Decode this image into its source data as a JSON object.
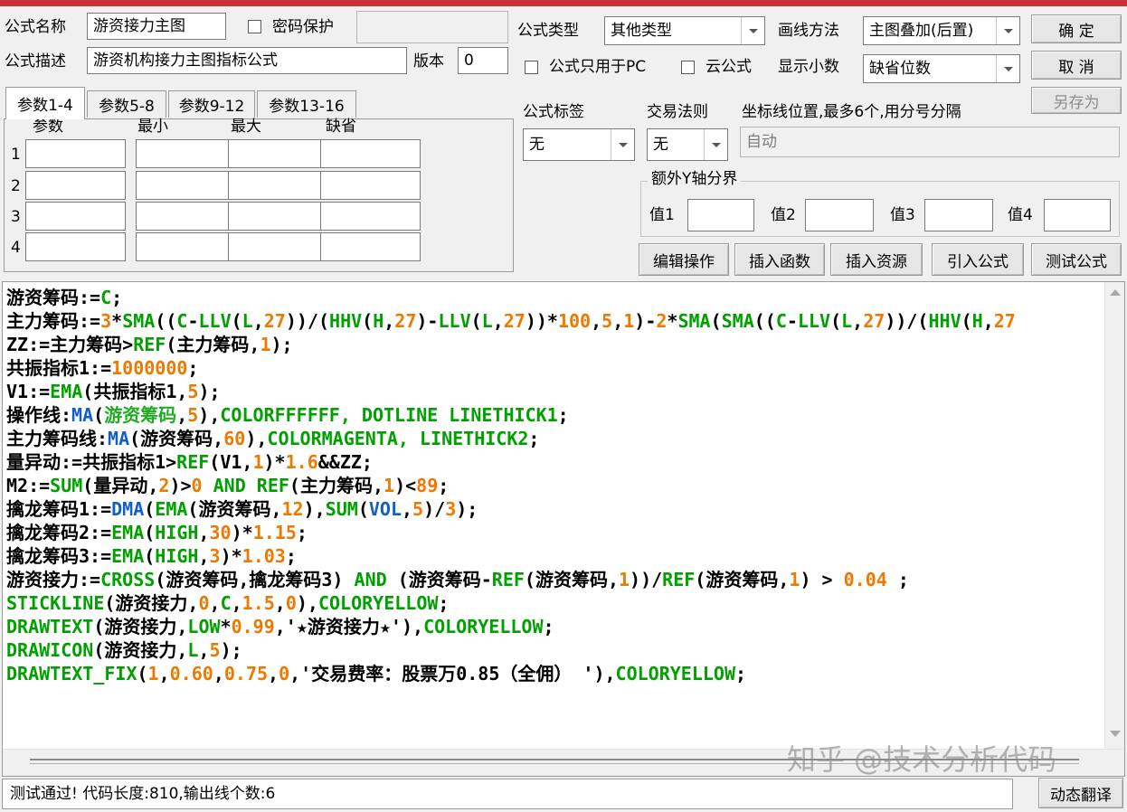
{
  "colors": {
    "code_default": "#000000",
    "code_keyword": "#00a000",
    "code_function": "#1060c8",
    "code_number": "#f07800",
    "code_highlight": "#22aa22",
    "accent_top": "#c9303a"
  },
  "header": {
    "name_label": "公式名称",
    "name_value": "游资接力主图",
    "password_label": "密码保护",
    "desc_label": "公式描述",
    "desc_value": "游资机构接力主图指标公式",
    "version_label": "版本",
    "version_value": "0",
    "type_label": "公式类型",
    "type_value": "其他类型",
    "draw_label": "画线方法",
    "draw_value": "主图叠加(后置)",
    "pc_only_label": "公式只用于PC",
    "cloud_label": "云公式",
    "decimals_label": "显示小数",
    "decimals_value": "缺省位数"
  },
  "buttons": {
    "ok": "确  定",
    "cancel": "取  消",
    "save_as": "另存为",
    "edit_ops": "编辑操作",
    "insert_func": "插入函数",
    "insert_resource": "插入资源",
    "import_formula": "引入公式",
    "test_formula": "测试公式",
    "dynamic_translate": "动态翻译"
  },
  "tabs": [
    "参数1-4",
    "参数5-8",
    "参数9-12",
    "参数13-16"
  ],
  "params": {
    "headers": [
      "参数",
      "最小",
      "最大",
      "缺省"
    ],
    "rows": [
      "1",
      "2",
      "3",
      "4"
    ]
  },
  "tags": {
    "tag_label": "公式标签",
    "tag_value": "无",
    "rule_label": "交易法则",
    "rule_value": "无",
    "axis_label": "坐标线位置,最多6个,用分号分隔",
    "axis_placeholder": "自动"
  },
  "y_axis": {
    "group_label": "额外Y轴分界",
    "v1": "值1",
    "v2": "值2",
    "v3": "值3",
    "v4": "值4"
  },
  "code": [
    [
      {
        "t": "游资筹码:=",
        "c": "d"
      },
      {
        "t": "C",
        "c": "k"
      },
      {
        "t": ";",
        "c": "d"
      }
    ],
    [
      {
        "t": "主力筹码:=",
        "c": "d"
      },
      {
        "t": "3",
        "c": "n"
      },
      {
        "t": "*",
        "c": "d"
      },
      {
        "t": "SMA",
        "c": "k"
      },
      {
        "t": "((",
        "c": "d"
      },
      {
        "t": "C",
        "c": "k"
      },
      {
        "t": "-",
        "c": "d"
      },
      {
        "t": "LLV",
        "c": "k"
      },
      {
        "t": "(",
        "c": "d"
      },
      {
        "t": "L",
        "c": "k"
      },
      {
        "t": ",",
        "c": "d"
      },
      {
        "t": "27",
        "c": "n"
      },
      {
        "t": "))/(",
        "c": "d"
      },
      {
        "t": "HHV",
        "c": "k"
      },
      {
        "t": "(",
        "c": "d"
      },
      {
        "t": "H",
        "c": "k"
      },
      {
        "t": ",",
        "c": "d"
      },
      {
        "t": "27",
        "c": "n"
      },
      {
        "t": ")-",
        "c": "d"
      },
      {
        "t": "LLV",
        "c": "k"
      },
      {
        "t": "(",
        "c": "d"
      },
      {
        "t": "L",
        "c": "k"
      },
      {
        "t": ",",
        "c": "d"
      },
      {
        "t": "27",
        "c": "n"
      },
      {
        "t": "))*",
        "c": "d"
      },
      {
        "t": "100",
        "c": "n"
      },
      {
        "t": ",",
        "c": "d"
      },
      {
        "t": "5",
        "c": "n"
      },
      {
        "t": ",",
        "c": "d"
      },
      {
        "t": "1",
        "c": "n"
      },
      {
        "t": ")-",
        "c": "d"
      },
      {
        "t": "2",
        "c": "n"
      },
      {
        "t": "*",
        "c": "d"
      },
      {
        "t": "SMA",
        "c": "k"
      },
      {
        "t": "(",
        "c": "d"
      },
      {
        "t": "SMA",
        "c": "k"
      },
      {
        "t": "((",
        "c": "d"
      },
      {
        "t": "C",
        "c": "k"
      },
      {
        "t": "-",
        "c": "d"
      },
      {
        "t": "LLV",
        "c": "k"
      },
      {
        "t": "(",
        "c": "d"
      },
      {
        "t": "L",
        "c": "k"
      },
      {
        "t": ",",
        "c": "d"
      },
      {
        "t": "27",
        "c": "n"
      },
      {
        "t": "))/(",
        "c": "d"
      },
      {
        "t": "HHV",
        "c": "k"
      },
      {
        "t": "(",
        "c": "d"
      },
      {
        "t": "H",
        "c": "k"
      },
      {
        "t": ",",
        "c": "d"
      },
      {
        "t": "27",
        "c": "n"
      }
    ],
    [
      {
        "t": "ZZ:=主力筹码>",
        "c": "d"
      },
      {
        "t": "REF",
        "c": "k"
      },
      {
        "t": "(主力筹码,",
        "c": "d"
      },
      {
        "t": "1",
        "c": "n"
      },
      {
        "t": ");",
        "c": "d"
      }
    ],
    [
      {
        "t": "共振指标1:=",
        "c": "d"
      },
      {
        "t": "1000000",
        "c": "n"
      },
      {
        "t": ";",
        "c": "d"
      }
    ],
    [
      {
        "t": "V1:=",
        "c": "d"
      },
      {
        "t": "EMA",
        "c": "k"
      },
      {
        "t": "(共振指标1,",
        "c": "d"
      },
      {
        "t": "5",
        "c": "n"
      },
      {
        "t": ");",
        "c": "d"
      }
    ],
    [
      {
        "t": "操作线:",
        "c": "d"
      },
      {
        "t": "MA",
        "c": "f"
      },
      {
        "t": "(",
        "c": "d"
      },
      {
        "t": "游资筹码",
        "c": "h"
      },
      {
        "t": ",",
        "c": "d"
      },
      {
        "t": "5",
        "c": "n"
      },
      {
        "t": "),",
        "c": "d"
      },
      {
        "t": "COLORFFFFFF, DOTLINE LINETHICK1",
        "c": "k"
      },
      {
        "t": ";",
        "c": "d"
      }
    ],
    [
      {
        "t": "主力筹码线:",
        "c": "d"
      },
      {
        "t": "MA",
        "c": "f"
      },
      {
        "t": "(游资筹码,",
        "c": "d"
      },
      {
        "t": "60",
        "c": "n"
      },
      {
        "t": "),",
        "c": "d"
      },
      {
        "t": "COLORMAGENTA, LINETHICK2",
        "c": "k"
      },
      {
        "t": ";",
        "c": "d"
      }
    ],
    [
      {
        "t": "量异动:=共振指标1>",
        "c": "d"
      },
      {
        "t": "REF",
        "c": "k"
      },
      {
        "t": "(V1,",
        "c": "d"
      },
      {
        "t": "1",
        "c": "n"
      },
      {
        "t": ")*",
        "c": "d"
      },
      {
        "t": "1.6",
        "c": "n"
      },
      {
        "t": "&&ZZ;",
        "c": "d"
      }
    ],
    [
      {
        "t": "M2:=",
        "c": "d"
      },
      {
        "t": "SUM",
        "c": "k"
      },
      {
        "t": "(量异动,",
        "c": "d"
      },
      {
        "t": "2",
        "c": "n"
      },
      {
        "t": ")>",
        "c": "d"
      },
      {
        "t": "0",
        "c": "n"
      },
      {
        "t": " ",
        "c": "d"
      },
      {
        "t": "AND",
        "c": "k"
      },
      {
        "t": " ",
        "c": "d"
      },
      {
        "t": "REF",
        "c": "k"
      },
      {
        "t": "(主力筹码,",
        "c": "d"
      },
      {
        "t": "1",
        "c": "n"
      },
      {
        "t": ")<",
        "c": "d"
      },
      {
        "t": "89",
        "c": "n"
      },
      {
        "t": ";",
        "c": "d"
      }
    ],
    [
      {
        "t": "擒龙筹码1:=",
        "c": "d"
      },
      {
        "t": "DMA",
        "c": "f"
      },
      {
        "t": "(",
        "c": "d"
      },
      {
        "t": "EMA",
        "c": "k"
      },
      {
        "t": "(游资筹码,",
        "c": "d"
      },
      {
        "t": "12",
        "c": "n"
      },
      {
        "t": "),",
        "c": "d"
      },
      {
        "t": "SUM",
        "c": "k"
      },
      {
        "t": "(",
        "c": "d"
      },
      {
        "t": "VOL",
        "c": "f"
      },
      {
        "t": ",",
        "c": "d"
      },
      {
        "t": "5",
        "c": "n"
      },
      {
        "t": ")/",
        "c": "d"
      },
      {
        "t": "3",
        "c": "n"
      },
      {
        "t": ");",
        "c": "d"
      }
    ],
    [
      {
        "t": "擒龙筹码2:=",
        "c": "d"
      },
      {
        "t": "EMA",
        "c": "k"
      },
      {
        "t": "(",
        "c": "d"
      },
      {
        "t": "HIGH",
        "c": "k"
      },
      {
        "t": ",",
        "c": "d"
      },
      {
        "t": "30",
        "c": "n"
      },
      {
        "t": ")*",
        "c": "d"
      },
      {
        "t": "1.15",
        "c": "n"
      },
      {
        "t": ";",
        "c": "d"
      }
    ],
    [
      {
        "t": "擒龙筹码3:=",
        "c": "d"
      },
      {
        "t": "EMA",
        "c": "k"
      },
      {
        "t": "(",
        "c": "d"
      },
      {
        "t": "HIGH",
        "c": "k"
      },
      {
        "t": ",",
        "c": "d"
      },
      {
        "t": "3",
        "c": "n"
      },
      {
        "t": ")*",
        "c": "d"
      },
      {
        "t": "1.03",
        "c": "n"
      },
      {
        "t": ";",
        "c": "d"
      }
    ],
    [
      {
        "t": "游资接力:=",
        "c": "d"
      },
      {
        "t": "CROSS",
        "c": "k"
      },
      {
        "t": "(游资筹码,擒龙筹码3) ",
        "c": "d"
      },
      {
        "t": "AND",
        "c": "k"
      },
      {
        "t": " (游资筹码-",
        "c": "d"
      },
      {
        "t": "REF",
        "c": "k"
      },
      {
        "t": "(游资筹码,",
        "c": "d"
      },
      {
        "t": "1",
        "c": "n"
      },
      {
        "t": "))/",
        "c": "d"
      },
      {
        "t": "REF",
        "c": "k"
      },
      {
        "t": "(游资筹码,",
        "c": "d"
      },
      {
        "t": "1",
        "c": "n"
      },
      {
        "t": ") > ",
        "c": "d"
      },
      {
        "t": "0.04",
        "c": "n"
      },
      {
        "t": " ;",
        "c": "d"
      }
    ],
    [
      {
        "t": "STICKLINE",
        "c": "k"
      },
      {
        "t": "(游资接力,",
        "c": "d"
      },
      {
        "t": "0",
        "c": "n"
      },
      {
        "t": ",",
        "c": "d"
      },
      {
        "t": "C",
        "c": "k"
      },
      {
        "t": ",",
        "c": "d"
      },
      {
        "t": "1.5",
        "c": "n"
      },
      {
        "t": ",",
        "c": "d"
      },
      {
        "t": "0",
        "c": "n"
      },
      {
        "t": "),",
        "c": "d"
      },
      {
        "t": "COLORYELLOW",
        "c": "k"
      },
      {
        "t": ";",
        "c": "d"
      }
    ],
    [
      {
        "t": "DRAWTEXT",
        "c": "k"
      },
      {
        "t": "(游资接力,",
        "c": "d"
      },
      {
        "t": "LOW",
        "c": "k"
      },
      {
        "t": "*",
        "c": "d"
      },
      {
        "t": "0.99",
        "c": "n"
      },
      {
        "t": ",'★游资接力★'),",
        "c": "d"
      },
      {
        "t": "COLORYELLOW",
        "c": "k"
      },
      {
        "t": ";",
        "c": "d"
      }
    ],
    [
      {
        "t": "DRAWICON",
        "c": "k"
      },
      {
        "t": "(游资接力,",
        "c": "d"
      },
      {
        "t": "L",
        "c": "k"
      },
      {
        "t": ",",
        "c": "d"
      },
      {
        "t": "5",
        "c": "n"
      },
      {
        "t": ");",
        "c": "d"
      }
    ],
    [
      {
        "t": "DRAWTEXT_FIX",
        "c": "k"
      },
      {
        "t": "(",
        "c": "d"
      },
      {
        "t": "1",
        "c": "n"
      },
      {
        "t": ",",
        "c": "d"
      },
      {
        "t": "0.60",
        "c": "n"
      },
      {
        "t": ",",
        "c": "d"
      },
      {
        "t": "0.75",
        "c": "n"
      },
      {
        "t": ",",
        "c": "d"
      },
      {
        "t": "0",
        "c": "n"
      },
      {
        "t": ",'交易费率：股票万0.85（全佣） '),",
        "c": "d"
      },
      {
        "t": "COLORYELLOW",
        "c": "k"
      },
      {
        "t": ";",
        "c": "d"
      }
    ]
  ],
  "status": {
    "text": "测试通过! 代码长度:810,输出线个数:6"
  },
  "watermark": "知乎 @技术分析代码"
}
